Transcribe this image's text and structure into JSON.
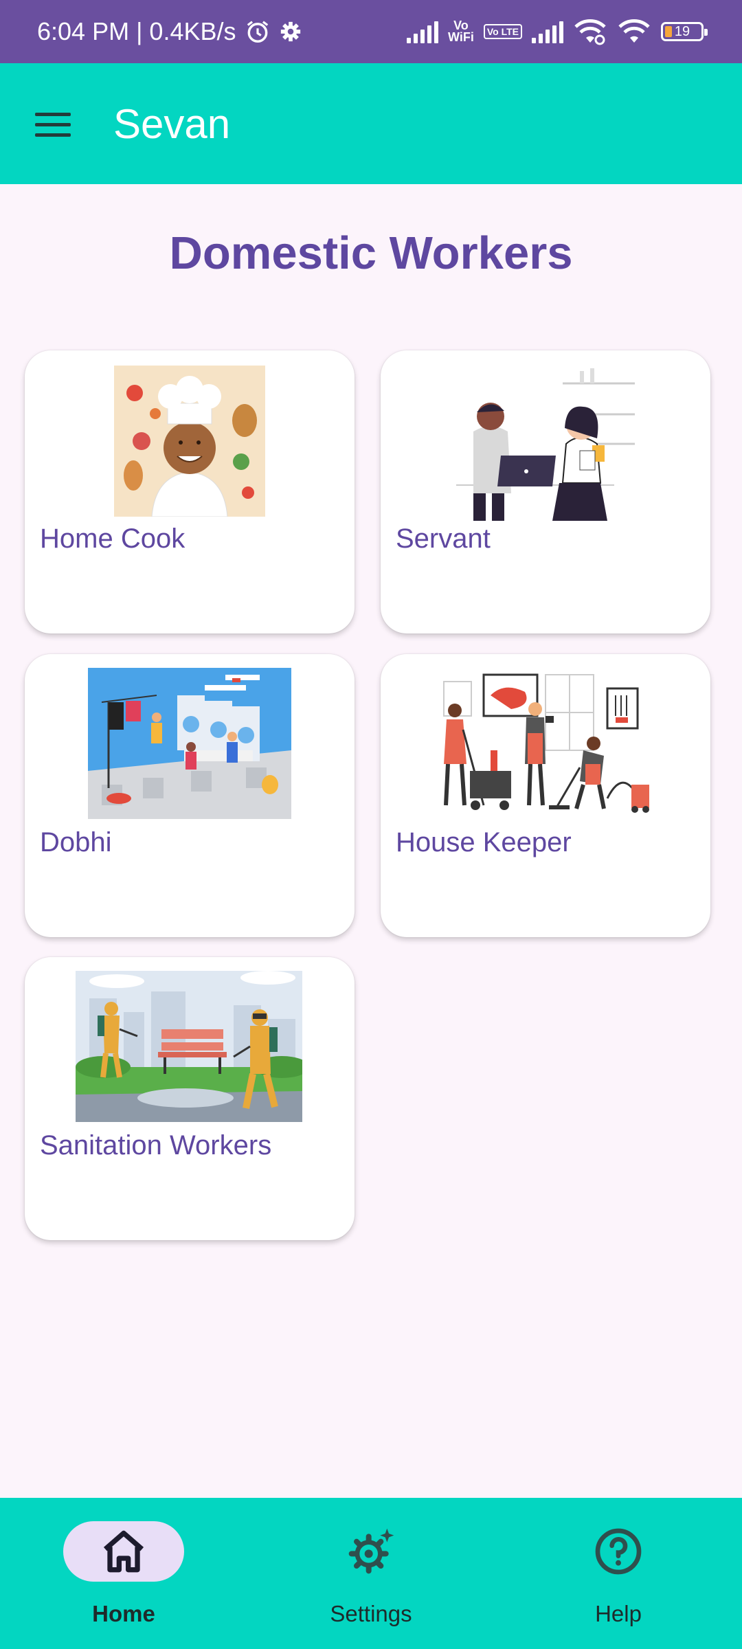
{
  "status_bar": {
    "time": "6:04 PM | 0.4KB/s",
    "vo_top": "Vo",
    "vo_bottom": "WiFi",
    "lte_box": "Vo LTE",
    "battery": "19",
    "icons": [
      "alarm-icon",
      "gear-icon",
      "signal-icon",
      "wifi-icon",
      "battery-icon"
    ]
  },
  "app_bar": {
    "title": "Sevan",
    "menu_icon": "menu-icon"
  },
  "page": {
    "title": "Domestic Workers"
  },
  "categories": [
    {
      "label": "Home Cook",
      "image": "chef-illustration"
    },
    {
      "label": "Servant",
      "image": "office-workers-illustration"
    },
    {
      "label": "Dobhi",
      "image": "laundry-illustration"
    },
    {
      "label": "House Keeper",
      "image": "cleaning-crew-illustration"
    },
    {
      "label": "Sanitation Workers",
      "image": "sanitation-illustration"
    }
  ],
  "bottom_nav": {
    "items": [
      {
        "label": "Home",
        "icon": "home-icon",
        "active": true
      },
      {
        "label": "Settings",
        "icon": "settings-sparkle-icon",
        "active": false
      },
      {
        "label": "Help",
        "icon": "help-circle-icon",
        "active": false
      }
    ]
  },
  "colors": {
    "status_bar": "#6a4f9f",
    "app_bar": "#03d6c1",
    "accent_text": "#5e47a0",
    "background": "#fcf4fb",
    "nav_pill": "#e8def7"
  }
}
